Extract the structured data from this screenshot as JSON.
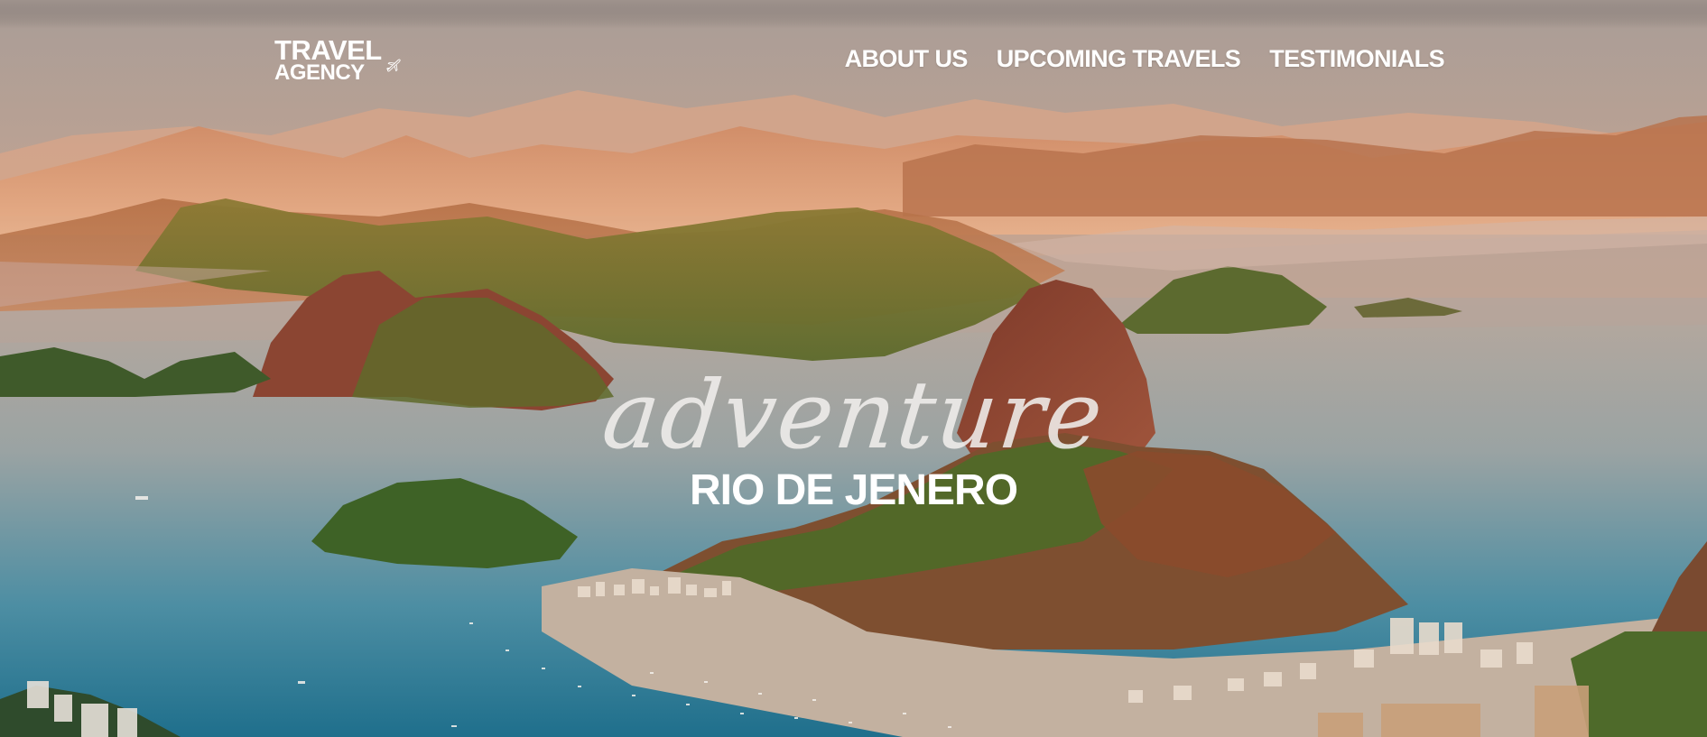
{
  "brand": {
    "line1": "TRAVEL",
    "line2": "AGENCY",
    "icon": "airplane-icon"
  },
  "nav": {
    "items": [
      {
        "label": "ABOUT US"
      },
      {
        "label": "UPCOMING TRAVELS"
      },
      {
        "label": "TESTIMONIALS"
      }
    ]
  },
  "hero": {
    "script_text": "adventure",
    "subtitle": "RIO DE JENERO",
    "image": "aerial-rio-sugarloaf-photo"
  },
  "colors": {
    "text": "#ffffff",
    "sky_top": "#b7a59a",
    "haze": "#e6a37a",
    "water": "#2f7f99"
  }
}
